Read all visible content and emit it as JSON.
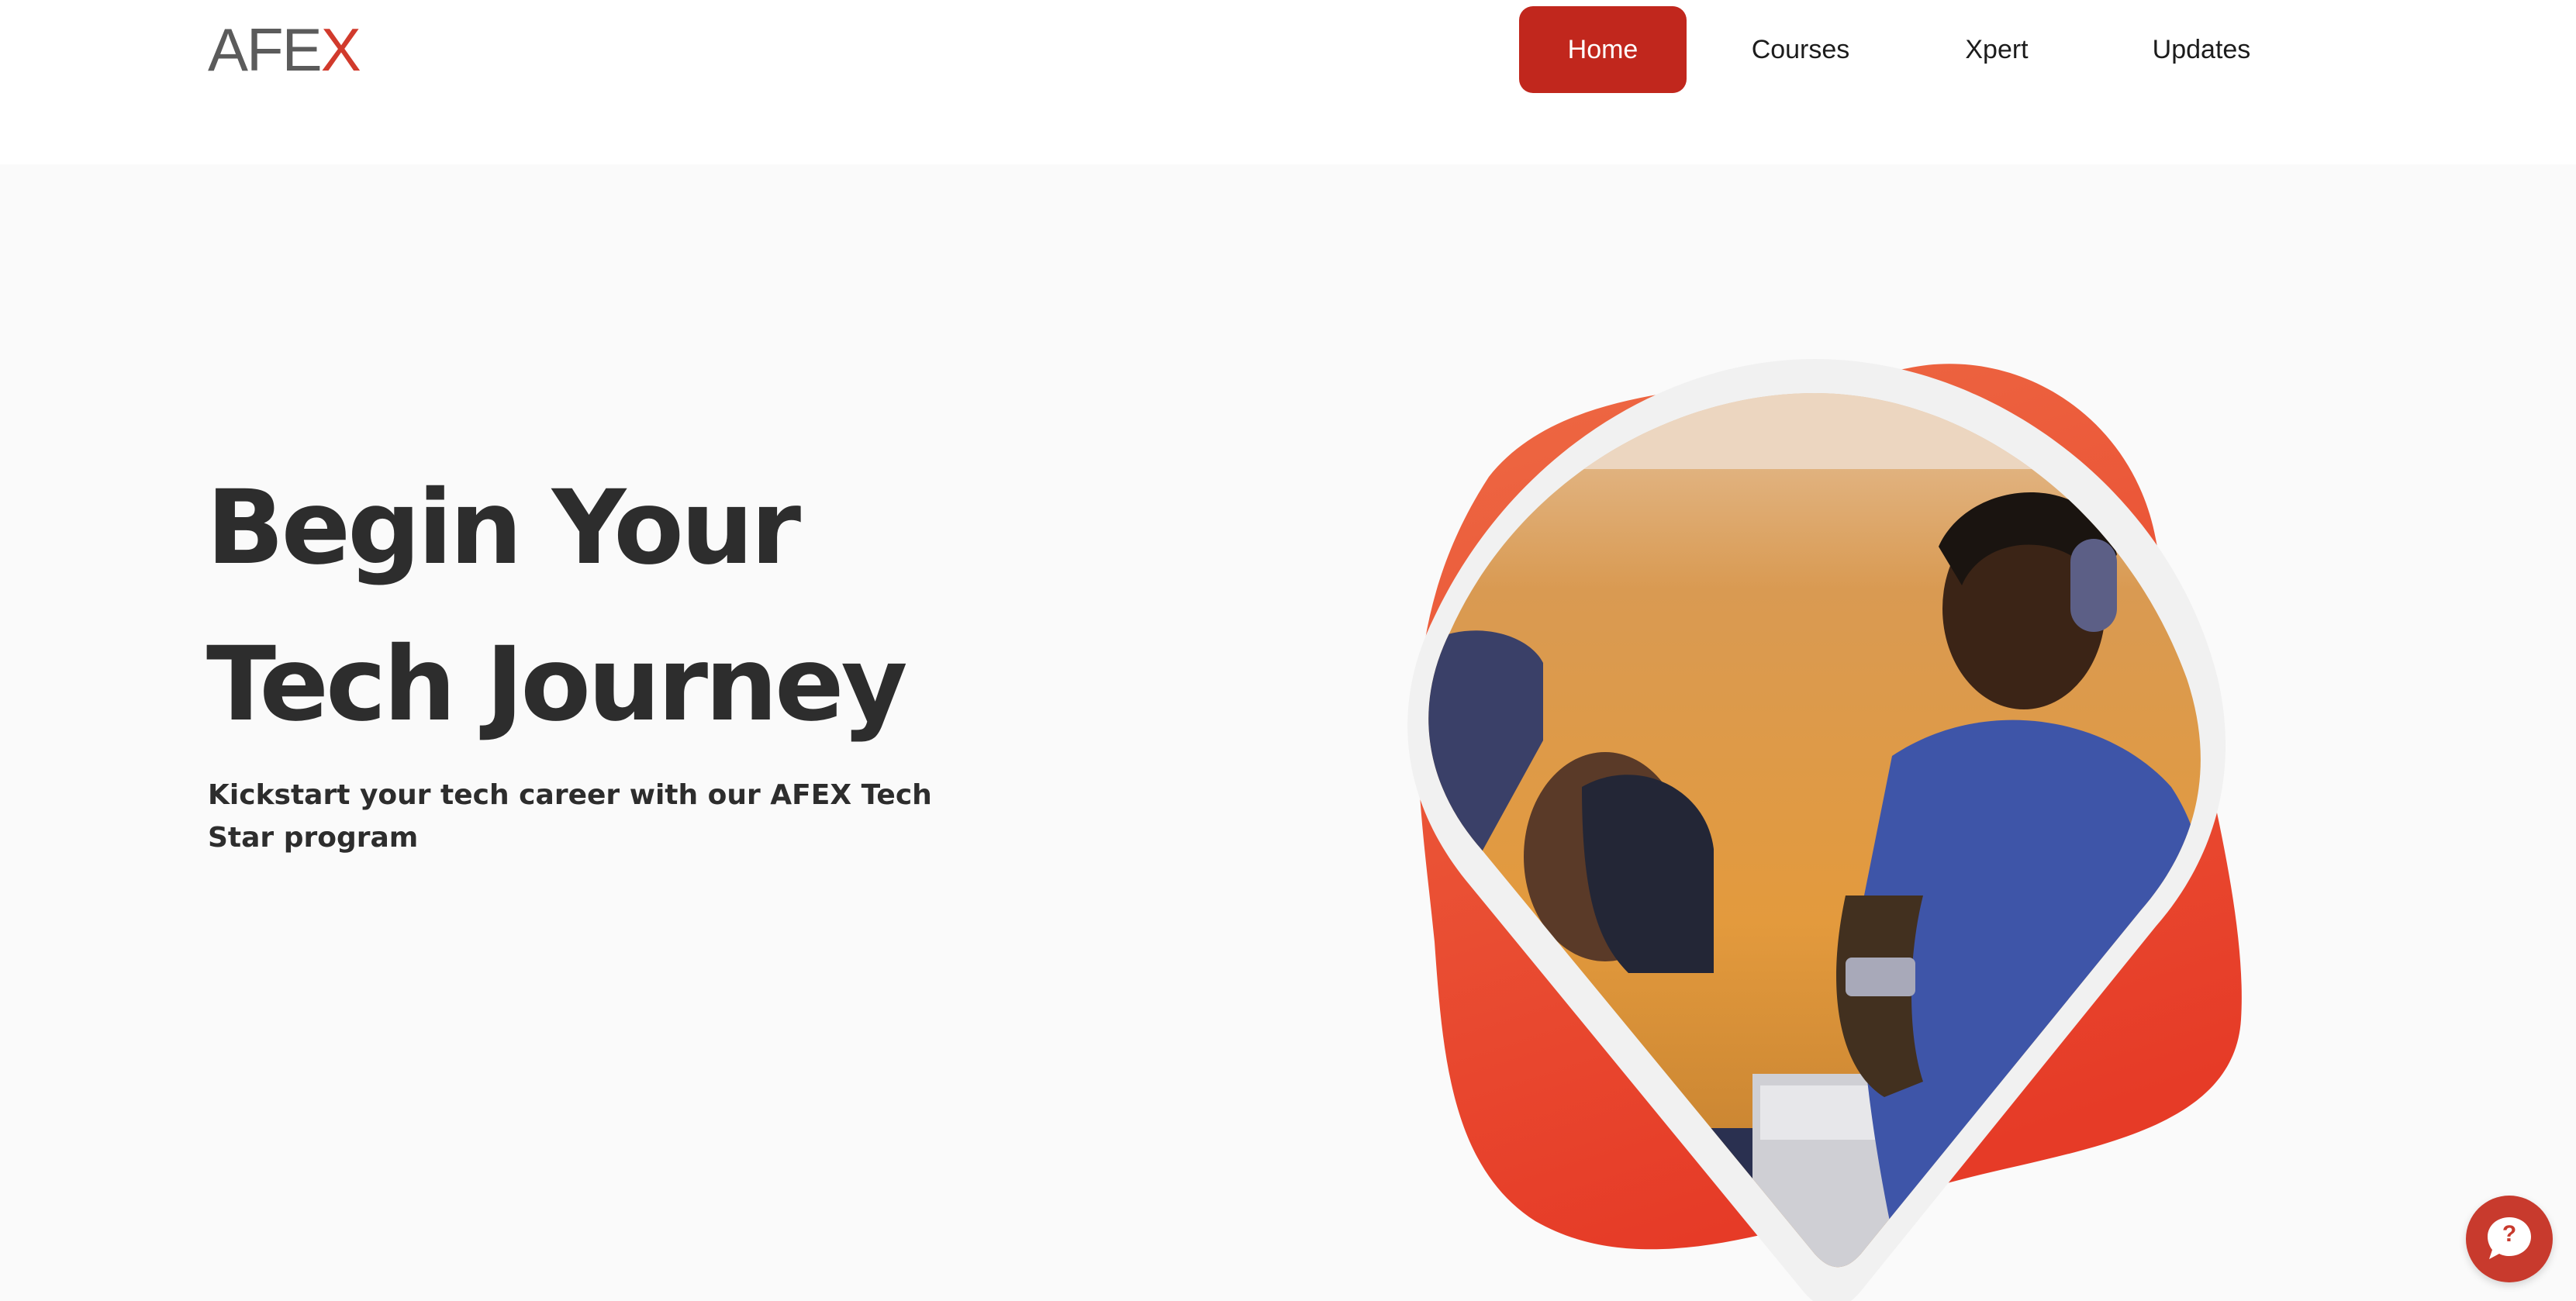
{
  "brand": {
    "logo_main": "AFE",
    "logo_accent": "X",
    "primary_color": "#c1271d",
    "accent_color": "#e8462c"
  },
  "nav": {
    "items": [
      {
        "label": "Home",
        "active": true
      },
      {
        "label": "Courses",
        "active": false
      },
      {
        "label": "Xpert",
        "active": false
      },
      {
        "label": "Updates",
        "active": false
      }
    ]
  },
  "hero": {
    "title_line1": "Begin Your",
    "title_line2": "Tech Journey",
    "subtitle": "Kickstart your tech career with our AFEX Tech Star program"
  },
  "help": {
    "icon": "help-chat-icon",
    "glyph": "?"
  }
}
